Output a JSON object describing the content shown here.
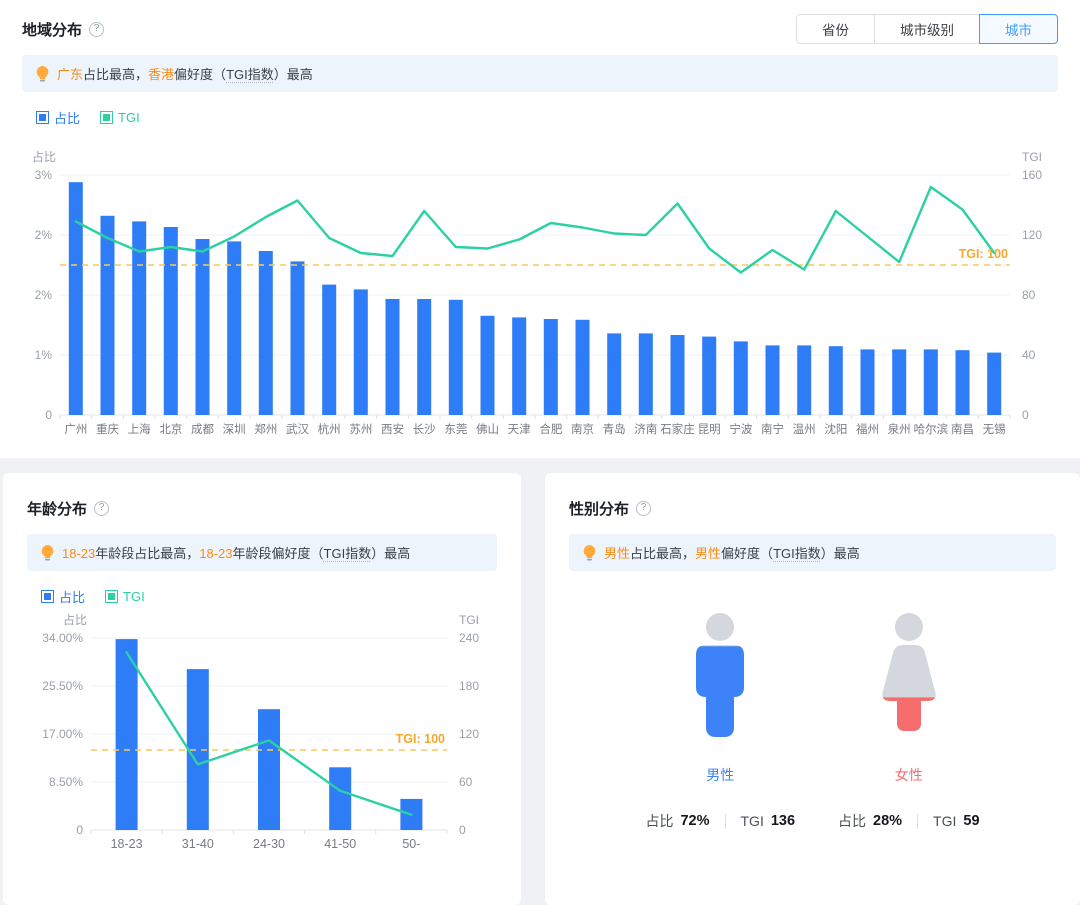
{
  "colors": {
    "bar_blue": "#2e7cf6",
    "line_green": "#2bd1a2",
    "ref_line": "#f7c95d",
    "ref_label": "#f5a82a",
    "highlight_orange": "#fa8c16",
    "active_tab_blue": "#409eff",
    "male_blue": "#3e82f7",
    "female_pink": "#f56d6d"
  },
  "region": {
    "title": "地域分布",
    "tabs": [
      {
        "label": "省份",
        "active": false
      },
      {
        "label": "城市级别",
        "active": false
      },
      {
        "label": "城市",
        "active": true
      }
    ],
    "insight_segments": [
      {
        "t": "广东",
        "hl": true
      },
      {
        "t": "占比最高，",
        "hl": false
      },
      {
        "t": "香港",
        "hl": true
      },
      {
        "t": "偏好度（",
        "hl": false
      },
      {
        "t": "TGI指数",
        "hl": false,
        "u": true
      },
      {
        "t": "）最高",
        "hl": false
      }
    ],
    "legend": {
      "ratio": "占比",
      "tgi": "TGI"
    }
  },
  "age": {
    "title": "年龄分布",
    "insight_segments": [
      {
        "t": "18-23",
        "hl": true
      },
      {
        "t": "年龄段占比最高，",
        "hl": false
      },
      {
        "t": "18-23",
        "hl": true
      },
      {
        "t": "年龄段偏好度（",
        "hl": false
      },
      {
        "t": "TGI指数",
        "hl": false,
        "u": true
      },
      {
        "t": "）最高",
        "hl": false
      }
    ],
    "legend": {
      "ratio": "占比",
      "tgi": "TGI"
    }
  },
  "gender": {
    "title": "性别分布",
    "insight_segments": [
      {
        "t": "男性",
        "hl": true
      },
      {
        "t": "占比最高，",
        "hl": false
      },
      {
        "t": "男性",
        "hl": true
      },
      {
        "t": "偏好度（",
        "hl": false
      },
      {
        "t": "TGI指数",
        "hl": false,
        "u": true
      },
      {
        "t": "）最高",
        "hl": false
      }
    ],
    "ratio_label": "占比",
    "tgi_label": "TGI",
    "items": [
      {
        "label": "男性",
        "ratio": "72%",
        "tgi": "136",
        "fill_pct": 72,
        "color": "#3e82f7"
      },
      {
        "label": "女性",
        "ratio": "28%",
        "tgi": "59",
        "fill_pct": 28,
        "color": "#f56d6d"
      }
    ]
  },
  "chart_data": [
    {
      "type": "combo_bar_line",
      "title": "地域分布（城市）",
      "legend": [
        "占比",
        "TGI"
      ],
      "legend_position": "top-left",
      "grid": true,
      "categories": [
        "广州",
        "重庆",
        "上海",
        "北京",
        "成都",
        "深圳",
        "郑州",
        "武汉",
        "杭州",
        "苏州",
        "西安",
        "长沙",
        "东莞",
        "佛山",
        "天津",
        "合肥",
        "南京",
        "青岛",
        "济南",
        "石家庄",
        "昆明",
        "宁波",
        "南宁",
        "温州",
        "沈阳",
        "福州",
        "泉州",
        "哈尔滨",
        "南昌",
        "无锡"
      ],
      "series": [
        {
          "name": "占比",
          "type": "bar",
          "axis": "left",
          "unit": "%",
          "values": [
            2.91,
            2.49,
            2.42,
            2.35,
            2.2,
            2.17,
            2.05,
            1.92,
            1.63,
            1.57,
            1.45,
            1.45,
            1.44,
            1.24,
            1.22,
            1.2,
            1.19,
            1.02,
            1.02,
            1.0,
            0.98,
            0.92,
            0.87,
            0.87,
            0.86,
            0.82,
            0.82,
            0.82,
            0.81,
            0.78
          ]
        },
        {
          "name": "TGI",
          "type": "line",
          "axis": "right",
          "values": [
            129,
            118,
            109,
            112,
            109,
            119,
            132,
            143,
            118,
            108,
            106,
            136,
            112,
            111,
            117,
            128,
            125,
            121,
            120,
            141,
            111,
            95,
            110,
            97,
            136,
            119,
            102,
            152,
            137,
            108
          ]
        }
      ],
      "y_left": {
        "title": "占比",
        "tick_labels": [
          "3%",
          "2%",
          "2%",
          "1%",
          "0"
        ],
        "tick_values": [
          3,
          2.25,
          1.5,
          0.75,
          0
        ]
      },
      "y_right": {
        "title": "TGI",
        "tick_labels": [
          "160",
          "120",
          "80",
          "40",
          "0"
        ],
        "tick_values": [
          160,
          120,
          80,
          40,
          0
        ]
      },
      "ref_line": {
        "value": 100,
        "label": "TGI: 100"
      }
    },
    {
      "type": "combo_bar_line",
      "title": "年龄分布",
      "legend": [
        "占比",
        "TGI"
      ],
      "legend_position": "top-left",
      "grid": true,
      "categories": [
        "18-23",
        "31-40",
        "24-30",
        "41-50",
        "50-"
      ],
      "series": [
        {
          "name": "占比",
          "type": "bar",
          "axis": "left",
          "unit": "%",
          "values": [
            33.8,
            28.5,
            21.4,
            11.1,
            5.5
          ]
        },
        {
          "name": "TGI",
          "type": "line",
          "axis": "right",
          "values": [
            222,
            82,
            112,
            49,
            19
          ]
        }
      ],
      "y_left": {
        "title": "占比",
        "tick_labels": [
          "34.00%",
          "25.50%",
          "17.00%",
          "8.50%",
          "0"
        ],
        "tick_values": [
          34,
          25.5,
          17,
          8.5,
          0
        ]
      },
      "y_right": {
        "title": "TGI",
        "tick_labels": [
          "240",
          "180",
          "120",
          "60",
          "0"
        ],
        "tick_values": [
          240,
          180,
          120,
          60,
          0
        ]
      },
      "ref_line": {
        "value": 100,
        "label": "TGI: 100"
      }
    },
    {
      "type": "table",
      "title": "性别分布",
      "columns": [
        "性别",
        "占比",
        "TGI"
      ],
      "rows": [
        [
          "男性",
          "72%",
          "136"
        ],
        [
          "女性",
          "28%",
          "59"
        ]
      ]
    }
  ]
}
